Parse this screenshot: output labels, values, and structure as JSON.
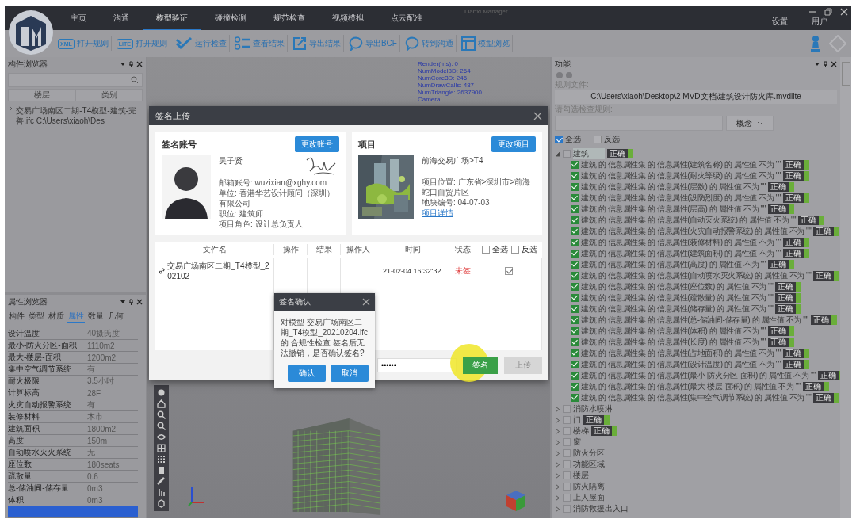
{
  "window": {
    "title": "Lianxi Manager",
    "menu_tabs": [
      {
        "label": "主页",
        "selected": false
      },
      {
        "label": "沟通",
        "selected": false
      },
      {
        "label": "模型验证",
        "selected": true
      },
      {
        "label": "碰撞检测",
        "selected": false
      },
      {
        "label": "规范检查",
        "selected": false
      },
      {
        "label": "视频模拟",
        "selected": false
      },
      {
        "label": "点云配准",
        "selected": false
      }
    ],
    "right_menu": [
      "设置",
      "用户"
    ]
  },
  "toolbar": [
    {
      "kind": "badge",
      "badge": "XML",
      "label": "打开规则"
    },
    {
      "kind": "badge",
      "badge": "LITE",
      "label": "打开规则"
    },
    {
      "kind": "check",
      "label": "运行检查"
    },
    {
      "kind": "list",
      "label": "查看结果"
    },
    {
      "kind": "export",
      "label": "导出结果"
    },
    {
      "kind": "bubble",
      "label": "导出BCF"
    },
    {
      "kind": "bubble",
      "label": "转到沟通"
    },
    {
      "kind": "layout",
      "label": "模型浏览"
    }
  ],
  "component_browser": {
    "title": "构件浏览器",
    "columns": [
      "楼层",
      "类别"
    ],
    "items": [
      {
        "label": "交易广场南区二期-T4模型-建筑-完善.ifc C:\\Users\\xiaoh\\Des",
        "expanded": false
      }
    ]
  },
  "property_browser": {
    "title": "属性浏览器",
    "tabs": [
      {
        "label": "构件",
        "selected": false
      },
      {
        "label": "类型",
        "selected": false
      },
      {
        "label": "材质",
        "selected": false
      },
      {
        "label": "属性",
        "selected": true
      },
      {
        "label": "数量",
        "selected": false
      },
      {
        "label": "几何",
        "selected": false
      }
    ],
    "rows": [
      {
        "name": "设计温度",
        "value": "40摄氏度",
        "selected": false
      },
      {
        "name": "最小-防火分区-面积",
        "value": "1110m2",
        "selected": false
      },
      {
        "name": "最大-楼层-面积",
        "value": "1200m2",
        "selected": false
      },
      {
        "name": "集中空气调节系统",
        "value": "有",
        "selected": false
      },
      {
        "name": "耐火极限",
        "value": "3.5小时",
        "selected": false
      },
      {
        "name": "计算标高",
        "value": "28F",
        "selected": false
      },
      {
        "name": "火灾自动报警系统",
        "value": "有",
        "selected": false
      },
      {
        "name": "装修材料",
        "value": "木市",
        "selected": false
      },
      {
        "name": "建筑面积",
        "value": "1800m2",
        "selected": false
      },
      {
        "name": "高度",
        "value": "150m",
        "selected": false
      },
      {
        "name": "自动喷水灭火系统",
        "value": "无",
        "selected": false
      },
      {
        "name": "座位数",
        "value": "180seats",
        "selected": false
      },
      {
        "name": "疏散量",
        "value": "0.6",
        "selected": false
      },
      {
        "name": "总-储油间-储存量",
        "value": "0m3",
        "selected": false
      },
      {
        "name": "体积",
        "value": "0m3",
        "selected": false
      },
      {
        "name": "",
        "value": "",
        "selected": true
      }
    ]
  },
  "viewport": {
    "stats": [
      "Render(ms): 0",
      "NumModel3D: 264",
      "NumCore3D: 246",
      "NumDrawCalls: 487",
      "NumTriangle: 2637900",
      "Camera"
    ]
  },
  "function_panel": {
    "title": "功能",
    "rule_file_label": "规则文件:",
    "rule_file": "C:\\Users\\xiaoh\\Desktop\\2 MVD文档\\建筑设计防火库.mvdlite",
    "rule_select_label": "请勾选检查规则:",
    "concept": "概念",
    "select_all": {
      "label": "全选",
      "checked": true
    },
    "invert": {
      "label": "反选",
      "checked": false
    },
    "tree": [
      {
        "label": "建筑",
        "checked": false,
        "expanded": true,
        "badge": "正确",
        "children": [
          {
            "label": "建筑 的 信息属性集 的 信息属性(建筑名称) 的 属性值 不为 \"\"",
            "checked": true,
            "badge": "正确"
          },
          {
            "label": "建筑 的 信息属性集 的 信息属性(耐火等级) 的 属性值 不为 \"\"",
            "checked": true,
            "badge": "正确"
          },
          {
            "label": "建筑 的 信息属性集 的 信息属性(层数) 的 属性值 不为 \"\"",
            "checked": true,
            "badge": "正确"
          },
          {
            "label": "建筑 的 信息属性集 的 信息属性(设防烈度) 的 属性值 不为 \"\"",
            "checked": true,
            "badge": "正确"
          },
          {
            "label": "建筑 的 信息属性集 的 信息属性(层高) 的 属性值 不为 \"\"",
            "checked": true,
            "badge": "正确"
          },
          {
            "label": "建筑 的 信息属性集 的 信息属性(自动灭火系统) 的 属性值 不为 \"\"",
            "checked": true,
            "badge": "正确"
          },
          {
            "label": "建筑 的 信息属性集 的 信息属性(火灾自动报警系统) 的 属性值 不为 \"\"",
            "checked": true,
            "badge": "正确"
          },
          {
            "label": "建筑 的 信息属性集 的 信息属性(装修材料) 的 属性值 不为 \"\"",
            "checked": true,
            "badge": "正确"
          },
          {
            "label": "建筑 的 信息属性集 的 信息属性(建筑面积) 的 属性值 不为 \"\"",
            "checked": true,
            "badge": "正确"
          },
          {
            "label": "建筑 的 信息属性集 的 信息属性(高度) 的 属性值 不为 \"\"",
            "checked": true,
            "badge": "正确"
          },
          {
            "label": "建筑 的 信息属性集 的 信息属性(自动喷水灭火系统) 的 属性值 不为 \"\"",
            "checked": true,
            "badge": "正确"
          },
          {
            "label": "建筑 的 信息属性集 的 信息属性(座位数) 的 属性值 不为 \"\"",
            "checked": true,
            "badge": "正确"
          },
          {
            "label": "建筑 的 信息属性集 的 信息属性(疏散量) 的 属性值 不为 \"\"",
            "checked": true,
            "badge": "正确"
          },
          {
            "label": "建筑 的 信息属性集 的 信息属性(储存量) 的 属性值 不为 \"\"",
            "checked": true,
            "badge": "正确"
          },
          {
            "label": "建筑 的 信息属性集 的 信息属性(总-储油间-储存量) 的 属性值 不为 \"\"",
            "checked": true,
            "badge": "正确"
          },
          {
            "label": "建筑 的 信息属性集 的 信息属性(体积) 的 属性值 不为 \"\"",
            "checked": true,
            "badge": "正确"
          },
          {
            "label": "建筑 的 信息属性集 的 信息属性(长度) 的 属性值 不为 \"\"",
            "checked": true,
            "badge": "正确"
          },
          {
            "label": "建筑 的 信息属性集 的 信息属性(占地面积) 的 属性值 不为 \"\"",
            "checked": true,
            "badge": "正确"
          },
          {
            "label": "建筑 的 信息属性集 的 信息属性(设计温度) 的 属性值 不为 \"\"",
            "checked": true,
            "badge": "正确"
          },
          {
            "label": "建筑 的 信息属性集 的 信息属性(最小-防火分区-面积) 的 属性值 不为 \"\"",
            "checked": true,
            "badge": "正确"
          },
          {
            "label": "建筑 的 信息属性集 的 信息属性(最大-楼层-面积) 的 属性值 不为 \"\"",
            "checked": true,
            "badge": "正确"
          },
          {
            "label": "建筑 的 信息属性集 的 信息属性(集中空气调节系统) 的 属性值 不为 \"\"",
            "checked": true,
            "badge": "正确"
          }
        ]
      },
      {
        "label": "消防水喷淋",
        "checked": false,
        "expanded": false
      },
      {
        "label": "门",
        "checked": false,
        "expanded": false,
        "badge": "正确"
      },
      {
        "label": "楼梯",
        "checked": false,
        "expanded": false,
        "badge": "正确"
      },
      {
        "label": "窗",
        "checked": false,
        "expanded": false
      },
      {
        "label": "防火分区",
        "checked": false,
        "expanded": false
      },
      {
        "label": "功能区域",
        "checked": false,
        "expanded": false
      },
      {
        "label": "楼层",
        "checked": false,
        "expanded": false
      },
      {
        "label": "防火隔离",
        "checked": false,
        "expanded": false
      },
      {
        "label": "上人屋面",
        "checked": false,
        "expanded": false
      },
      {
        "label": "消防救援出入口",
        "checked": false,
        "expanded": false
      }
    ]
  },
  "sign_dialog": {
    "title": "签名上传",
    "account": {
      "heading": "签名账号",
      "change_button": "更改账号",
      "name": "吴子贤",
      "lines": [
        "邮箱账号: wuzixian@xghy.com",
        "单位: 香港华艺设计顾问（深圳）有限公司",
        "职位: 建筑师",
        "项目角色: 设计总负责人"
      ]
    },
    "project": {
      "heading": "项目",
      "change_button": "更改项目",
      "name": "前海交易广场>T4",
      "lines": [
        "项目位置: 广东省>深圳市>前海蛇口自贸片区",
        "地块编号: 04-07-03"
      ],
      "link": "项目详情"
    },
    "columns": [
      "文件名",
      "操作",
      "结果",
      "操作人",
      "时间",
      "状态"
    ],
    "select_all": {
      "label": "全选",
      "checked": false
    },
    "invert": {
      "label": "反选",
      "checked": false
    },
    "rows": [
      {
        "file": "交易广场南区二期_T4模型_202102",
        "time": "21-02-04 16:32:32",
        "status": "未签",
        "checked": true
      }
    ],
    "password": "••••••",
    "sign_button": "签名",
    "upload_button": {
      "label": "上传",
      "disabled": true
    },
    "confirm": {
      "title": "签名确认",
      "message": "对模型 交易广场南区二期_T4模型_20210204.ifc 的 合规性检查 签名后无法撤销，是否确认签名?",
      "ok": "确认",
      "cancel": "取消"
    }
  }
}
